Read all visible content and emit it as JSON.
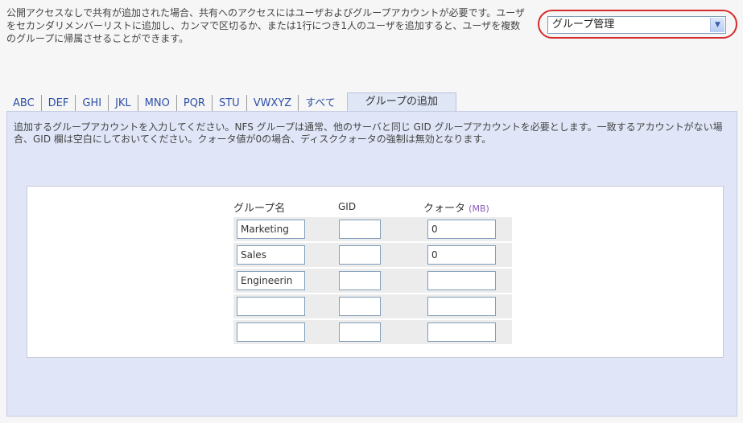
{
  "intro": "公開アクセスなしで共有が追加された場合、共有へのアクセスにはユーザおよびグループアカウントが必要です。ユーザをセカンダリメンバーリストに追加し、カンマで区切るか、または1行につき1人のユーザを追加すると、ユーザを複数のグループに帰属させることができます。",
  "selector": {
    "value": "グループ管理"
  },
  "tabs": [
    {
      "label": "ABC"
    },
    {
      "label": "DEF"
    },
    {
      "label": "GHI"
    },
    {
      "label": "JKL"
    },
    {
      "label": "MNO"
    },
    {
      "label": "PQR"
    },
    {
      "label": "STU"
    },
    {
      "label": "VWXYZ"
    },
    {
      "label": "すべて"
    },
    {
      "label": "グループの追加"
    }
  ],
  "description": "追加するグループアカウントを入力してください。NFS グループは通常、他のサーバと同じ GID グループアカウントを必要とします。一致するアカウントがない場合、GID 欄は空白にしておいてください。クォータ値が0の場合、ディスククォータの強制は無効となります。",
  "table": {
    "headers": {
      "name": "グループ名",
      "gid": "GID",
      "quota": "クォータ",
      "quota_unit": "(MB)"
    },
    "rows": [
      {
        "name": "Marketing",
        "gid": "",
        "quota": "0"
      },
      {
        "name": "Sales",
        "gid": "",
        "quota": "0"
      },
      {
        "name": "Engineerin",
        "gid": "",
        "quota": ""
      },
      {
        "name": "",
        "gid": "",
        "quota": ""
      },
      {
        "name": "",
        "gid": "",
        "quota": ""
      }
    ]
  },
  "colors": {
    "highlight": "#d62b2b",
    "link": "#2d4fa8",
    "panel": "#e0e6f7"
  },
  "icons": [
    "chevron-down-icon"
  ]
}
